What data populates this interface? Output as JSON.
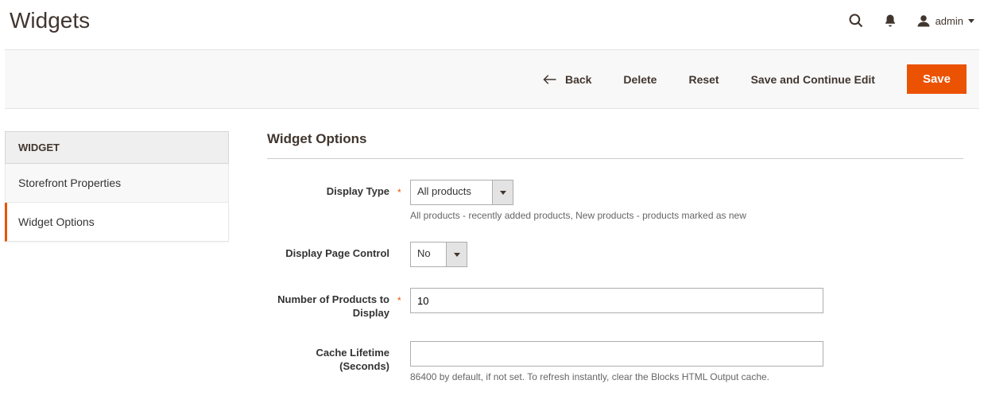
{
  "header": {
    "title": "Widgets",
    "user": "admin"
  },
  "actions": {
    "back": "Back",
    "delete": "Delete",
    "reset": "Reset",
    "save_continue": "Save and Continue Edit",
    "save": "Save"
  },
  "sidebar": {
    "heading": "WIDGET",
    "items": [
      {
        "label": "Storefront Properties"
      },
      {
        "label": "Widget Options"
      }
    ]
  },
  "section": {
    "title": "Widget Options"
  },
  "form": {
    "display_type": {
      "label": "Display Type",
      "value": "All products",
      "hint": "All products - recently added products, New products - products marked as new"
    },
    "display_page_control": {
      "label": "Display Page Control",
      "value": "No"
    },
    "num_products": {
      "label": "Number of Products to Display",
      "value": "10"
    },
    "cache_lifetime": {
      "label": "Cache Lifetime (Seconds)",
      "value": "",
      "hint": "86400 by default, if not set. To refresh instantly, clear the Blocks HTML Output cache."
    }
  }
}
